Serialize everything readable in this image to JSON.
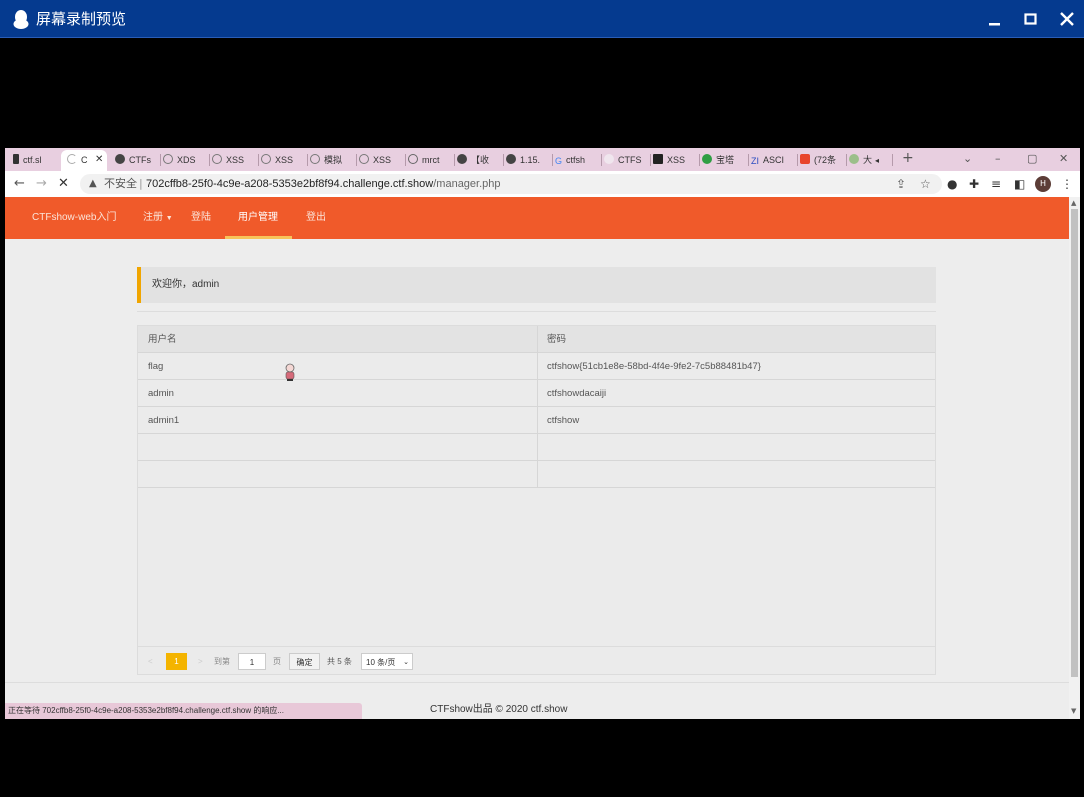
{
  "window": {
    "title": "屏幕录制预览",
    "controls": [
      "minimize-icon",
      "maximize-icon",
      "close-icon"
    ]
  },
  "browser": {
    "tabs": [
      {
        "label": "ctf.sl",
        "icon": "runner-icon"
      },
      {
        "label": "C",
        "icon": "loading-icon",
        "active": true
      },
      {
        "label": "CTFs",
        "icon": "globe-icon"
      },
      {
        "label": "XDS",
        "icon": "site-icon"
      },
      {
        "label": "XSS",
        "icon": "site-icon"
      },
      {
        "label": "XSS",
        "icon": "site-icon"
      },
      {
        "label": "模拟",
        "icon": "site-icon"
      },
      {
        "label": "XSS",
        "icon": "site-icon"
      },
      {
        "label": "mrct",
        "icon": "github-icon"
      },
      {
        "label": "【收",
        "icon": "globe-icon"
      },
      {
        "label": "1.15.",
        "icon": "globe-icon"
      },
      {
        "label": "ctfsh",
        "icon": "google-icon"
      },
      {
        "label": "CTFS",
        "icon": "site-icon"
      },
      {
        "label": "XSS",
        "icon": "m-icon"
      },
      {
        "label": "宝塔",
        "icon": "bt-icon"
      },
      {
        "label": "ASCI",
        "icon": "zi-icon"
      },
      {
        "label": "(72条",
        "icon": "c-icon"
      },
      {
        "label": "大",
        "icon": "site-icon"
      }
    ],
    "new_tab": "+",
    "address": {
      "insecure_label": "不安全",
      "host": "702cffb8-25f0-4c9e-a208-5353e2bf8f94.challenge.ctf.show",
      "path": "/manager.php"
    },
    "avatar_letter": "H",
    "status_text": "正在等待 702cffb8-25f0-4c9e-a208-5353e2bf8f94.challenge.ctf.show 的响应..."
  },
  "site": {
    "brand": "CTFshow-web入门",
    "nav": [
      {
        "label": "注册"
      },
      {
        "label": "登陆"
      },
      {
        "label": "用户管理",
        "active": true
      },
      {
        "label": "登出"
      }
    ],
    "welcome": "欢迎你，admin",
    "table": {
      "headers": [
        "用户名",
        "密码"
      ],
      "rows": [
        [
          "flag",
          "ctfshow{51cb1e8e-58bd-4f4e-9fe2-7c5b88481b47}"
        ],
        [
          "admin",
          "ctfshowdacaiji"
        ],
        [
          "admin1",
          "ctfshow"
        ],
        [
          "",
          ""
        ],
        [
          "",
          ""
        ]
      ]
    },
    "pager": {
      "current": "1",
      "goto_label": "到第",
      "page_input": "1",
      "page_unit": "页",
      "confirm": "确定",
      "total": "共 5 条",
      "page_size": "10 条/页"
    },
    "footer": "CTFshow出品 © 2020 ctf.show"
  },
  "colors": {
    "navbar": "#f05a2a",
    "accent": "#f4b400",
    "window_title": "#053a8f"
  }
}
